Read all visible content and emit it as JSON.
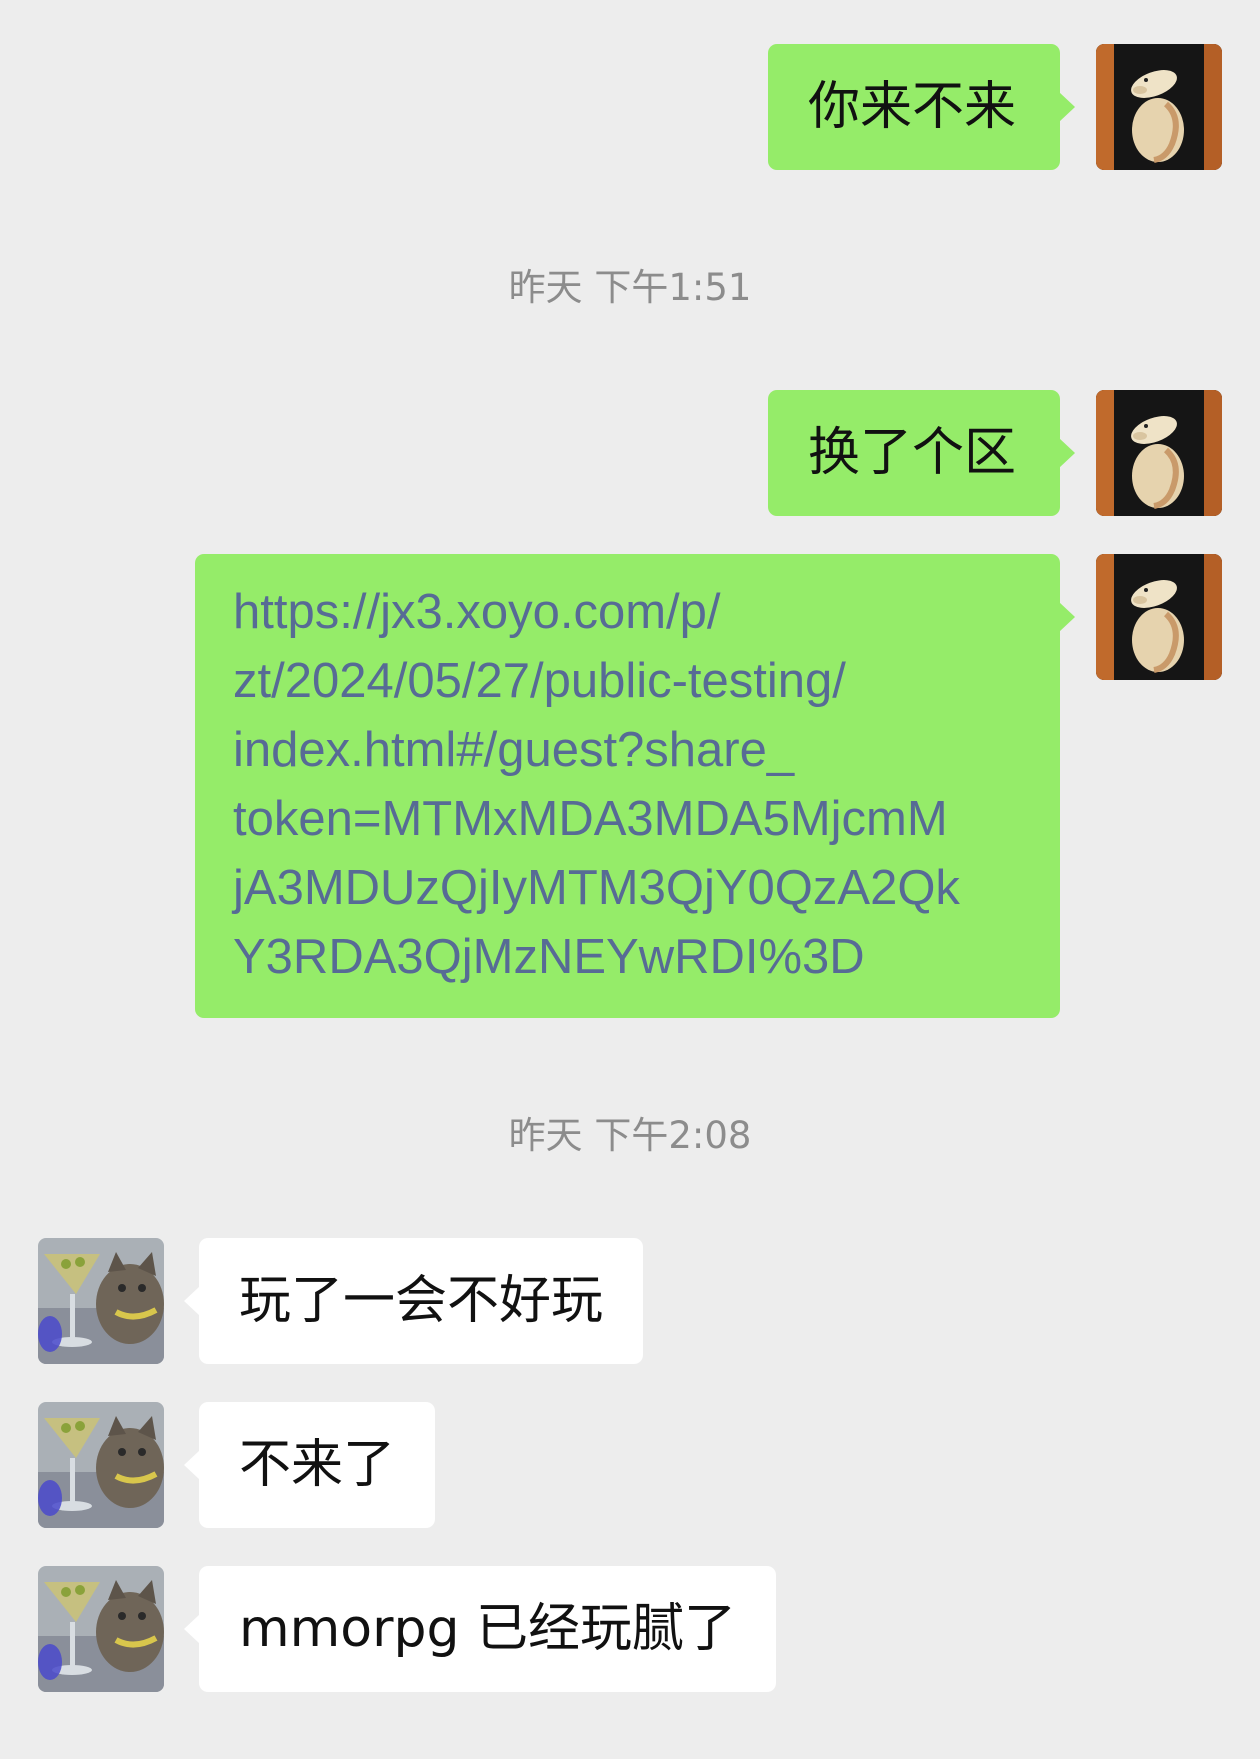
{
  "colors": {
    "background": "#ededed",
    "outgoing_bubble": "#95ec69",
    "incoming_bubble": "#ffffff",
    "link": "#576b95",
    "timestamp": "#8c8c8c"
  },
  "messages": {
    "m1": {
      "text": "你来不来"
    },
    "t1": {
      "text": "昨天 下午1:51"
    },
    "m2": {
      "text": "换了个区"
    },
    "m3": {
      "lines": [
        "https://jx3.xoyo.com/p/",
        "zt/2024/05/27/public-testing/",
        "index.html#/guest?share_",
        "token=MTMxMDA3MDA5MjcmM",
        "jA3MDUzQjIyMTM3QjY0QzA2Qk",
        "Y3RDA3QjMzNEYwRDI%3D"
      ]
    },
    "t2": {
      "text": "昨天 下午2:08"
    },
    "m4": {
      "text": "玩了一会不好玩"
    },
    "m5": {
      "text": "不来了"
    },
    "m6": {
      "text": "mmorpg 已经玩腻了"
    }
  },
  "avatars": {
    "self": "lamb-portrait-avatar",
    "contact": "cat-martini-avatar"
  }
}
